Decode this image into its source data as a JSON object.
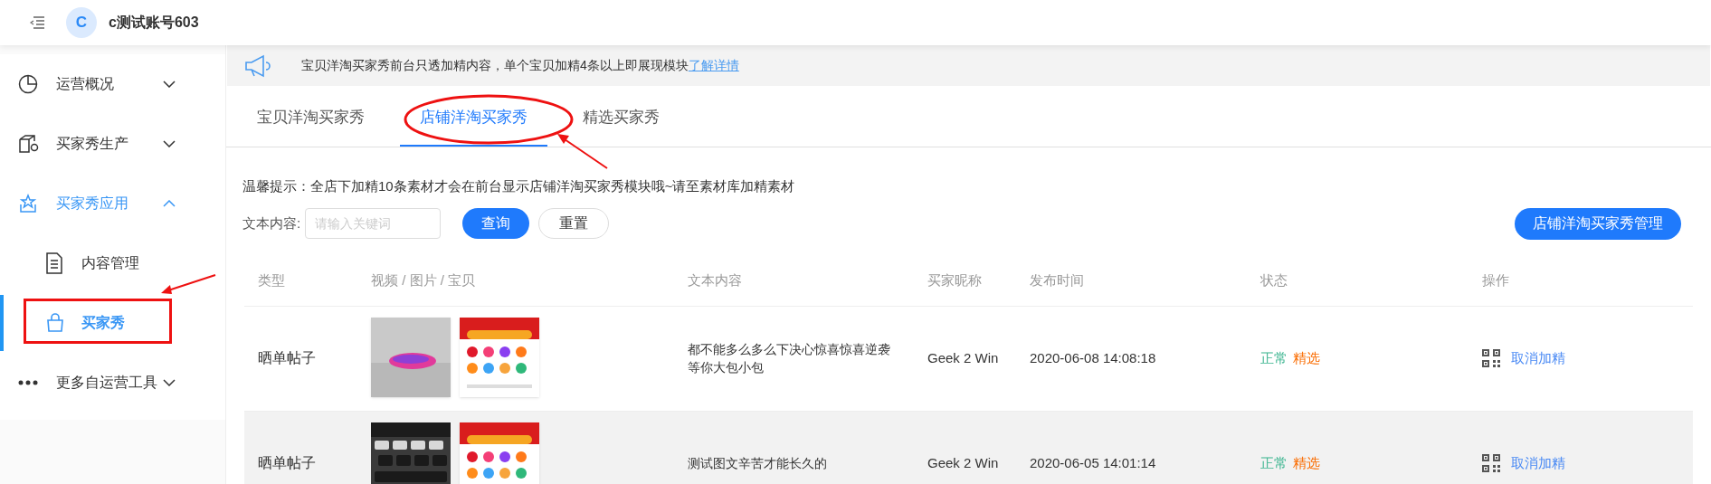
{
  "header": {
    "avatar": "C",
    "account": "c测试账号603"
  },
  "sidebar": {
    "items": [
      {
        "label": "运营概况",
        "expanded": false,
        "selected": false
      },
      {
        "label": "买家秀生产",
        "expanded": false,
        "selected": false
      },
      {
        "label": "买家秀应用",
        "expanded": true,
        "selected": true,
        "children": [
          {
            "label": "内容管理",
            "selected": false
          },
          {
            "label": "买家秀",
            "selected": true
          }
        ]
      },
      {
        "label": "更多自运营工具",
        "expanded": false,
        "selected": false
      }
    ]
  },
  "notice": {
    "text": "宝贝洋淘买家秀前台只透加精内容，单个宝贝加精4条以上即展现模块",
    "link": "了解详情"
  },
  "tabs": [
    {
      "label": "宝贝洋淘买家秀",
      "selected": false
    },
    {
      "label": "店铺洋淘买家秀",
      "selected": true
    },
    {
      "label": "精选买家秀",
      "selected": false
    }
  ],
  "tip": "温馨提示：全店下加精10条素材才会在前台显示店铺洋淘买家秀模块哦~请至素材库加精素材",
  "filter": {
    "label": "文本内容:",
    "placeholder": "请输入关键词",
    "search_button": "查询",
    "reset_button": "重置",
    "manage_button": "店铺洋淘买家秀管理"
  },
  "table": {
    "columns": [
      "类型",
      "视频 / 图片 / 宝贝",
      "文本内容",
      "买家昵称",
      "发布时间",
      "状态",
      "操作"
    ],
    "rows": [
      {
        "type": "晒单帖子",
        "text": "都不能多么多么下决心惊喜惊喜逆袭等你大包小包",
        "nickname": "Geek 2 Win",
        "time": "2020-06-08 14:08:18",
        "statuses": [
          {
            "label": "正常",
            "color": "#3cb590"
          },
          {
            "label": "精选",
            "color": "#fa6c00"
          }
        ],
        "action": "取消加精",
        "hovered": false
      },
      {
        "type": "晒单帖子",
        "text": "测试图文辛苦才能长久的",
        "nickname": "Geek 2 Win",
        "time": "2020-06-05 14:01:14",
        "statuses": [
          {
            "label": "正常",
            "color": "#3cb590"
          },
          {
            "label": "精选",
            "color": "#fa6c00"
          }
        ],
        "action": "取消加精",
        "hovered": true
      }
    ]
  }
}
